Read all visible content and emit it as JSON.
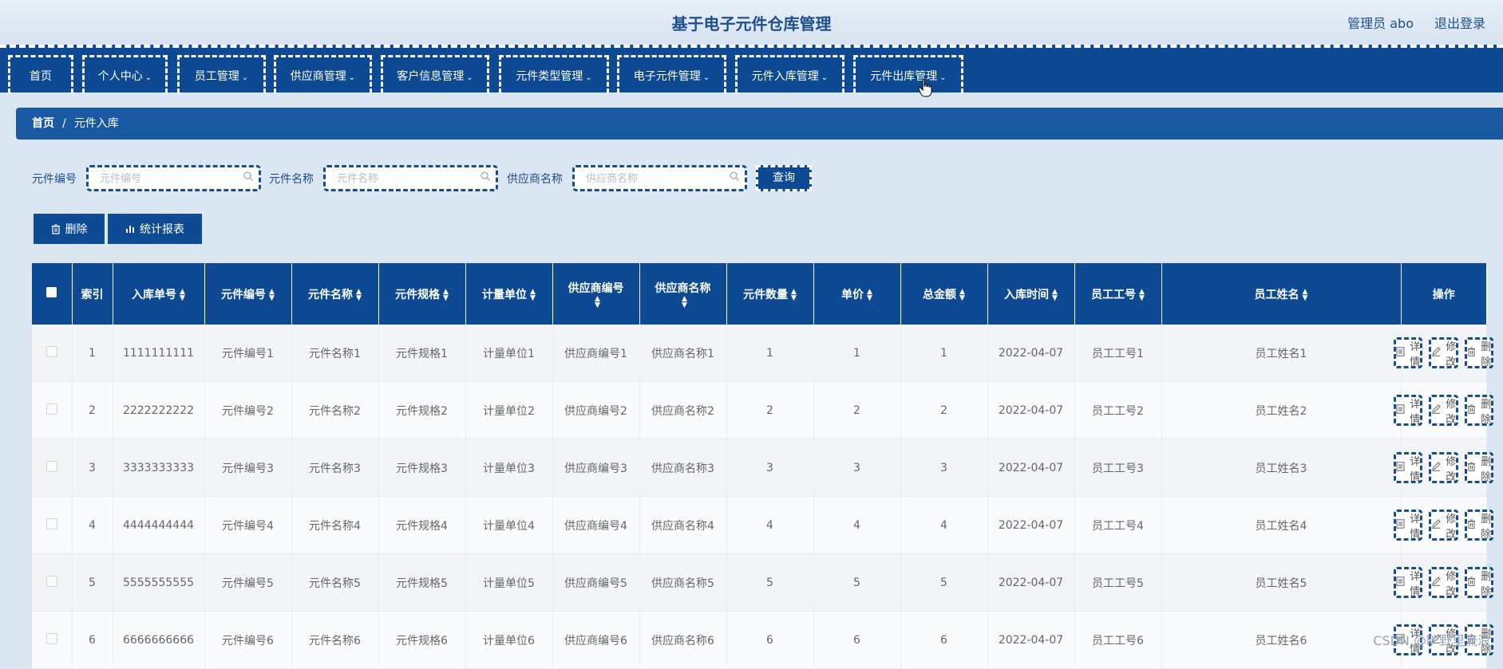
{
  "header": {
    "title": "基于电子元件仓库管理",
    "user_label": "管理员 abo",
    "logout_label": "退出登录"
  },
  "nav": {
    "items": [
      {
        "label": "首页",
        "has_dropdown": false
      },
      {
        "label": "个人中心",
        "has_dropdown": true
      },
      {
        "label": "员工管理",
        "has_dropdown": true
      },
      {
        "label": "供应商管理",
        "has_dropdown": true
      },
      {
        "label": "客户信息管理",
        "has_dropdown": true
      },
      {
        "label": "元件类型管理",
        "has_dropdown": true
      },
      {
        "label": "电子元件管理",
        "has_dropdown": true
      },
      {
        "label": "元件入库管理",
        "has_dropdown": true
      },
      {
        "label": "元件出库管理",
        "has_dropdown": true
      }
    ]
  },
  "breadcrumb": {
    "home": "首页",
    "separator": "/",
    "current": "元件入库"
  },
  "search": {
    "fields": [
      {
        "label": "元件编号",
        "placeholder": "元件编号",
        "value": ""
      },
      {
        "label": "元件名称",
        "placeholder": "元件名称",
        "value": ""
      },
      {
        "label": "供应商名称",
        "placeholder": "供应商名称",
        "value": ""
      }
    ],
    "query_label": "查询"
  },
  "actions": {
    "delete_label": "删除",
    "report_label": "统计报表"
  },
  "table": {
    "columns": [
      "索引",
      "入库单号",
      "元件编号",
      "元件名称",
      "元件规格",
      "计量单位",
      "供应商编号",
      "供应商名称",
      "元件数量",
      "单价",
      "总金额",
      "入库时间",
      "员工工号",
      "员工姓名",
      "操作"
    ],
    "rows": [
      {
        "index": "1",
        "order_no": "1111111111",
        "code": "元件编号1",
        "name": "元件名称1",
        "spec": "元件规格1",
        "unit": "计量单位1",
        "supplier_no": "供应商编号1",
        "supplier_name": "供应商名称1",
        "qty": "1",
        "price": "1",
        "total": "1",
        "time": "2022-04-07",
        "emp_no": "员工工号1",
        "emp_name": "员工姓名1"
      },
      {
        "index": "2",
        "order_no": "2222222222",
        "code": "元件编号2",
        "name": "元件名称2",
        "spec": "元件规格2",
        "unit": "计量单位2",
        "supplier_no": "供应商编号2",
        "supplier_name": "供应商名称2",
        "qty": "2",
        "price": "2",
        "total": "2",
        "time": "2022-04-07",
        "emp_no": "员工工号2",
        "emp_name": "员工姓名2"
      },
      {
        "index": "3",
        "order_no": "3333333333",
        "code": "元件编号3",
        "name": "元件名称3",
        "spec": "元件规格3",
        "unit": "计量单位3",
        "supplier_no": "供应商编号3",
        "supplier_name": "供应商名称3",
        "qty": "3",
        "price": "3",
        "total": "3",
        "time": "2022-04-07",
        "emp_no": "员工工号3",
        "emp_name": "员工姓名3"
      },
      {
        "index": "4",
        "order_no": "4444444444",
        "code": "元件编号4",
        "name": "元件名称4",
        "spec": "元件规格4",
        "unit": "计量单位4",
        "supplier_no": "供应商编号4",
        "supplier_name": "供应商名称4",
        "qty": "4",
        "price": "4",
        "total": "4",
        "time": "2022-04-07",
        "emp_no": "员工工号4",
        "emp_name": "员工姓名4"
      },
      {
        "index": "5",
        "order_no": "5555555555",
        "code": "元件编号5",
        "name": "元件名称5",
        "spec": "元件规格5",
        "unit": "计量单位5",
        "supplier_no": "供应商编号5",
        "supplier_name": "供应商名称5",
        "qty": "5",
        "price": "5",
        "total": "5",
        "time": "2022-04-07",
        "emp_no": "员工工号5",
        "emp_name": "员工姓名5"
      },
      {
        "index": "6",
        "order_no": "6666666666",
        "code": "元件编号6",
        "name": "元件名称6",
        "spec": "元件规格6",
        "unit": "计量单位6",
        "supplier_no": "供应商编号6",
        "supplier_name": "供应商名称6",
        "qty": "6",
        "price": "6",
        "total": "6",
        "time": "2022-04-07",
        "emp_no": "员工工号6",
        "emp_name": "员工姓名6"
      }
    ],
    "op_labels": {
      "detail": "详情",
      "edit": "修改",
      "delete": "删除"
    }
  },
  "watermark": "CSDN @旷野里流浪",
  "icons": {
    "search": "search-icon",
    "trash": "trash-icon",
    "chart": "bar-chart-icon",
    "doc": "document-icon",
    "pencil": "pencil-icon",
    "chevron": "chevron-down-icon",
    "cursor": "hand-cursor-icon"
  },
  "colors": {
    "primary": "#0d4a93",
    "breadcrumb": "#1a5aa3",
    "page_bg": "#dbe6f3",
    "title": "#1d4f8f"
  }
}
